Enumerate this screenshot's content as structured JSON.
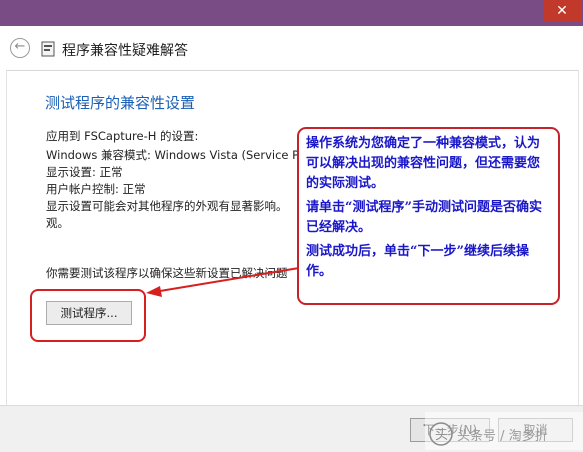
{
  "window": {
    "title": "程序兼容性疑难解答",
    "close_glyph": "✕"
  },
  "main": {
    "heading": "测试程序的兼容性设置",
    "settings": [
      "应用到  FSCapture-H 的设置:",
      "Windows 兼容模式: Windows Vista (Service Pack",
      "显示设置:  正常",
      "用户帐户控制:  正常",
      "显示设置可能会对其他程序的外观有显著影响。",
      "观。"
    ],
    "prompt": "你需要测试该程序以确保这些新设置已解决问题",
    "test_button": "测试程序..."
  },
  "callout": {
    "paragraphs": [
      "操作系统为您确定了一种兼容模式，认为可以解决出现的兼容性问题，但还需要您的实际测试。",
      "请单击“测试程序”手动测试问题是否确实已经解决。",
      "测试成功后，单击“下一步”继续后续操作。"
    ]
  },
  "footer": {
    "next_button": "下一步(N)",
    "cancel_button": "取消"
  },
  "watermark": {
    "text": "头条号 / 淘多折"
  },
  "colors": {
    "titlebar": "#7a4c86",
    "close": "#c1392b",
    "heading": "#1a5fb4",
    "callout_text": "#1a17c9",
    "callout_border": "#c6222a",
    "frame": "#d62020"
  }
}
